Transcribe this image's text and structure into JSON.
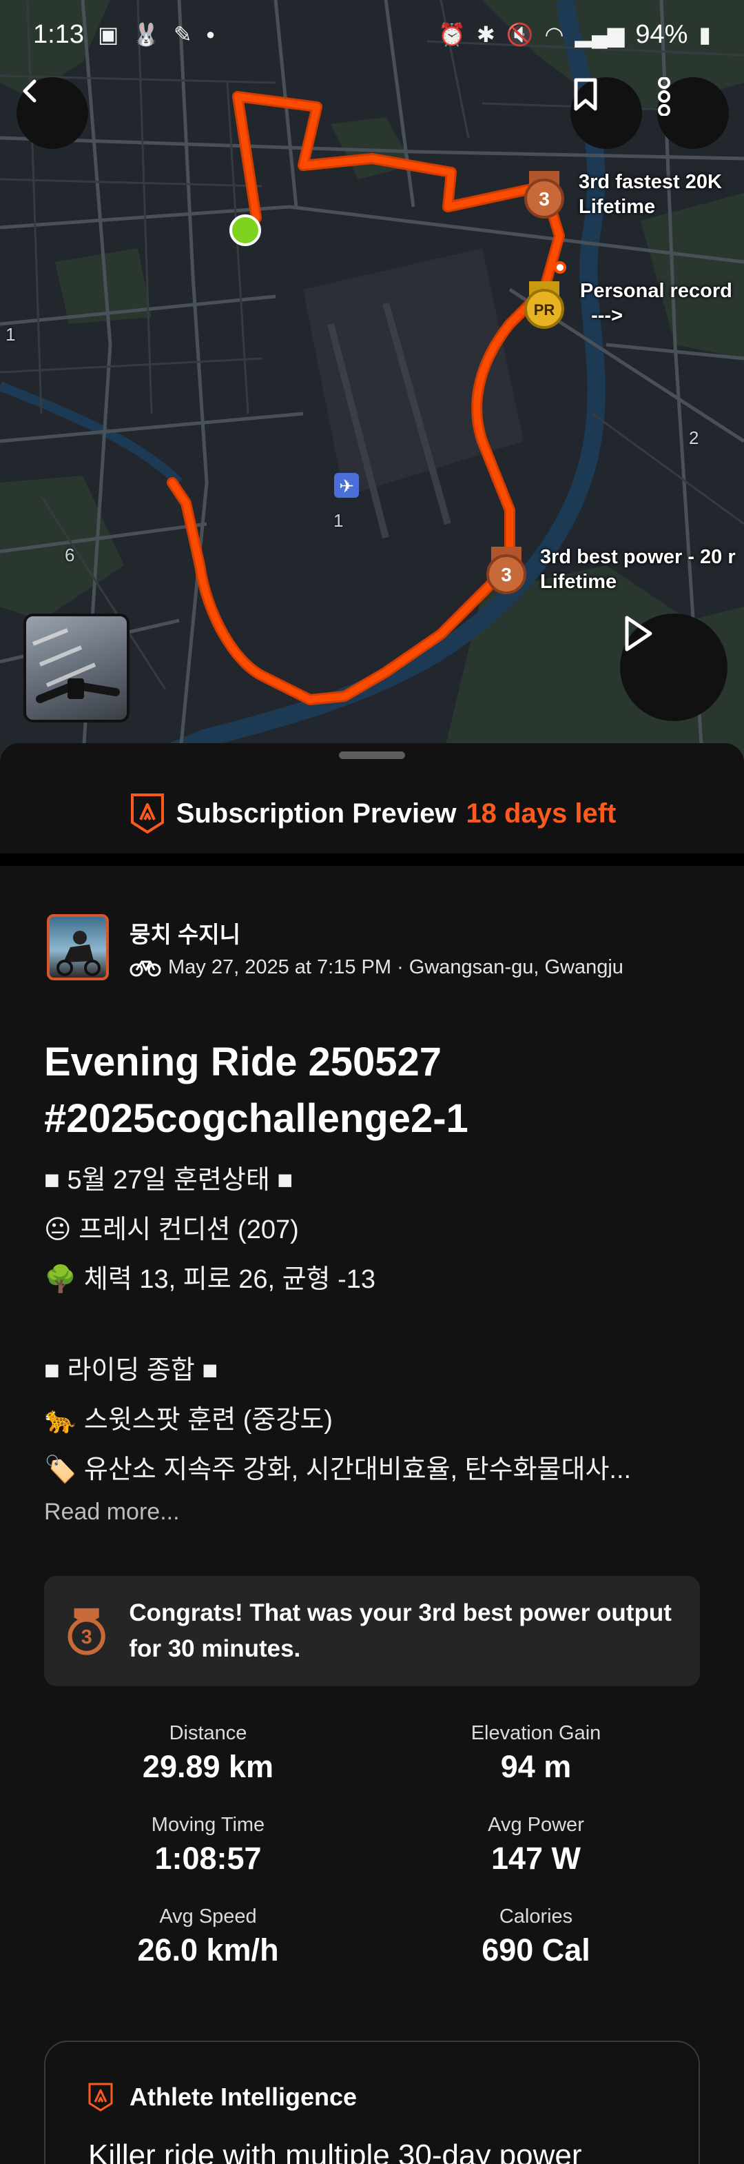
{
  "status_bar": {
    "time": "1:13",
    "battery": "94%",
    "left_icons": [
      "gallery-icon",
      "rabbit-icon",
      "pen-icon",
      "dot-icon"
    ],
    "right_icons": [
      "alarm-icon",
      "bluetooth-icon",
      "mute-icon",
      "wifi-icon",
      "signal-icon",
      "battery-icon"
    ]
  },
  "map": {
    "labels": {
      "third_fastest": "3rd fastest 20K\nLifetime",
      "personal_record": "Personal record\n  --->",
      "third_power": "3rd best power - 20 r\nLifetime"
    },
    "medal_3": "3",
    "medal_pr": "PR",
    "road_numbers": [
      "1",
      "2",
      "6",
      "1"
    ],
    "airport_number": "1",
    "route_color": "#fc4c02"
  },
  "sheet": {
    "promo_label": "Subscription Preview",
    "promo_days": "18 days left",
    "athlete": {
      "name": "뭉치 수지니",
      "meta": "May 27, 2025 at 7:15 PM · Gwangsan-gu, Gwangju"
    },
    "title": "Evening Ride 250527 #2025cogchallenge2-1",
    "description": [
      "■ 5월 27일 훈련상태 ■",
      "😐 프레시 컨디션 (207)",
      "🌳 체력 13, 피로 26, 균형 -13",
      "",
      "■ 라이딩 종합 ■",
      "🐆 스윗스팟 훈련 (중강도)",
      "🏷️ 유산소 지속주 강화, 시간대비효율, 탄수화물대사..."
    ],
    "read_more": "Read more...",
    "congrats": {
      "medal": "3",
      "text": "Congrats! That was your 3rd best power output for 30 minutes."
    },
    "stats": [
      {
        "label": "Distance",
        "value": "29.89 km"
      },
      {
        "label": "Elevation Gain",
        "value": "94 m"
      },
      {
        "label": "Moving Time",
        "value": "1:08:57"
      },
      {
        "label": "Avg Power",
        "value": "147 W"
      },
      {
        "label": "Avg Speed",
        "value": "26.0 km/h"
      },
      {
        "label": "Calories",
        "value": "690 Cal"
      }
    ],
    "athlete_intelligence": {
      "title": "Athlete Intelligence",
      "body": "Killer ride with multiple 30-day power"
    }
  },
  "colors": {
    "brand_orange": "#fc5a1f",
    "bronze": "#c8693a",
    "gold": "#e8b322",
    "start_green": "#7ed321",
    "background": "#121212"
  }
}
